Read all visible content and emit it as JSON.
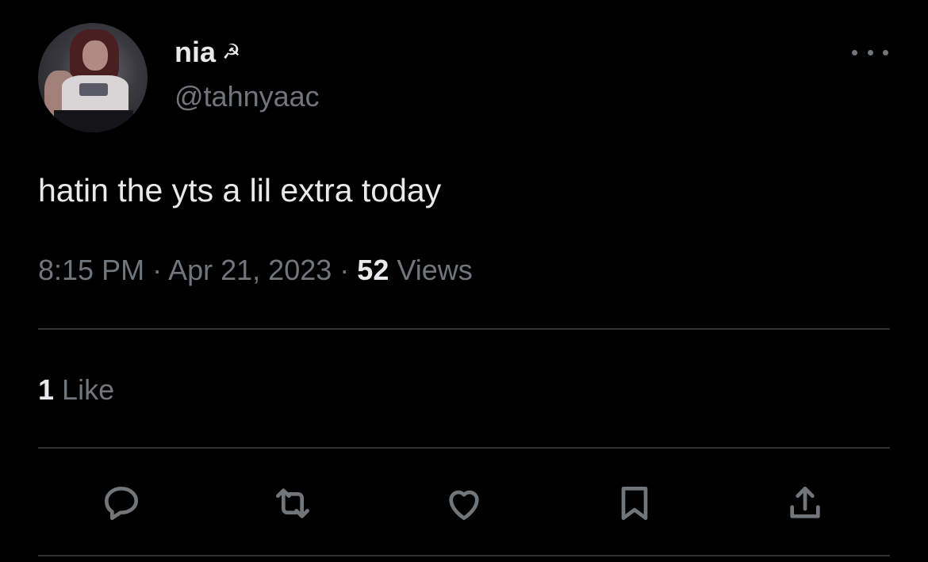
{
  "user": {
    "display_name": "nia",
    "name_emoji": "☭",
    "handle": "@tahnyaac"
  },
  "tweet": {
    "text": "hatin the yts a lil extra today",
    "time": "8:15 PM",
    "date": "Apr 21, 2023",
    "separator": "·",
    "views_count": "52",
    "views_label": "Views"
  },
  "engagement": {
    "likes_count": "1",
    "likes_label": "Like"
  },
  "actions": {
    "icons": [
      "reply-icon",
      "retweet-icon",
      "like-icon",
      "bookmark-icon",
      "share-icon"
    ]
  },
  "colors": {
    "background": "#000000",
    "primary_text": "#e7e9ea",
    "secondary_text": "#71767b",
    "divider": "#2f3336"
  }
}
